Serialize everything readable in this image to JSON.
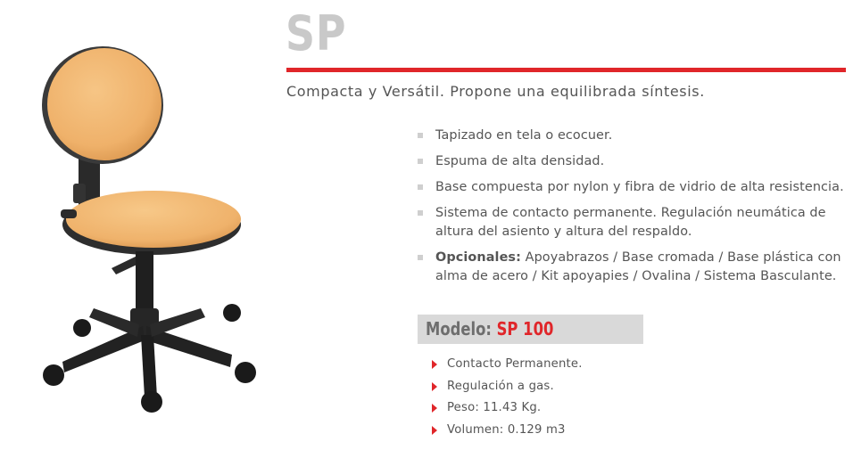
{
  "product": {
    "title": "SP",
    "subtitle": "Compacta y Versátil. Propone una equilibrada síntesis."
  },
  "features": [
    {
      "text": "Tapizado en tela o ecocuer."
    },
    {
      "text": "Espuma de alta densidad."
    },
    {
      "text": "Base compuesta por nylon y fibra de vidrio de alta resistencia."
    },
    {
      "text": "Sistema de contacto permanente. Regulación neumática de altura del asiento y altura del respaldo."
    },
    {
      "label": "Opcionales:",
      "text": " Apoyabrazos / Base cromada / Base plástica con alma de acero / Kit apoyapies / Ovalina / Sistema Basculante."
    }
  ],
  "model": {
    "label": "Modelo:",
    "value": "SP 100"
  },
  "specs": [
    "Contacto Permanente.",
    "Regulación a gas.",
    "Peso: 11.43 Kg.",
    "Volumen: 0.129 m3"
  ],
  "colors": {
    "accent": "#e0262a",
    "title": "#c9c9c9",
    "text": "#555555",
    "model_bar": "#d9d9d9",
    "upholstery": "#f0b66e"
  }
}
